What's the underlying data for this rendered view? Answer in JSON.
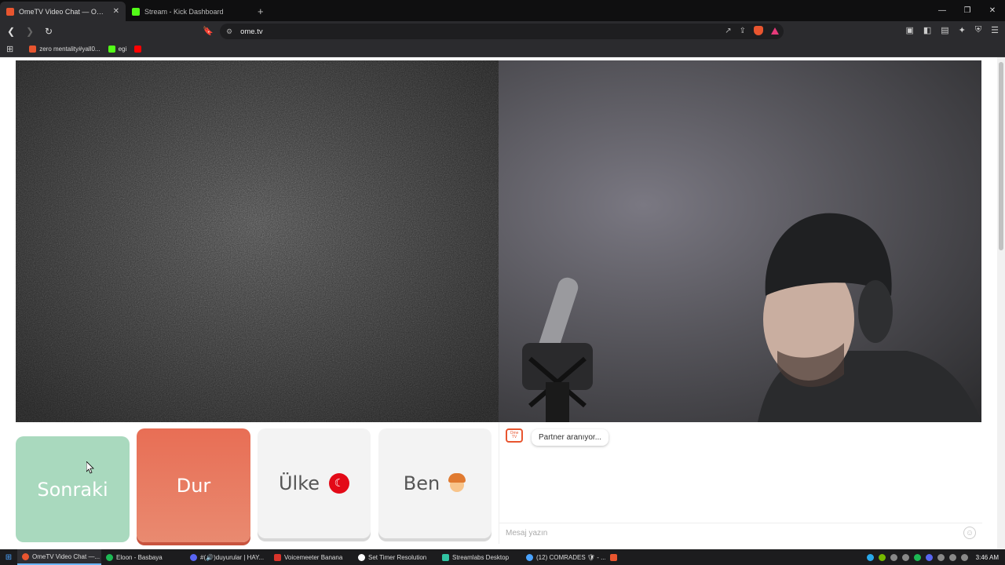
{
  "browser": {
    "tabs": [
      {
        "title": "OmeTV Video Chat — Omeg",
        "favicon_color": "#e8552f",
        "active": true
      },
      {
        "title": "Stream - Kick Dashboard",
        "favicon_color": "#53fc18",
        "active": false
      }
    ],
    "new_tab_symbol": "+",
    "window_controls": {
      "minimize": "—",
      "restore": "❐",
      "close": "✕"
    },
    "url": "ome.tv",
    "bookmarks": [
      {
        "label": "zero mentality#yall0...",
        "color": "#e8552f"
      },
      {
        "label": "egi",
        "color": "#53fc18"
      },
      {
        "label": "",
        "color": "#ff0000"
      }
    ]
  },
  "page": {
    "buttons": {
      "next": "Sonraki",
      "stop": "Dur",
      "country": "Ülke",
      "me": "Ben"
    },
    "chat": {
      "logo_text": "Ome TV",
      "status_message": "Partner aranıyor...",
      "input_placeholder": "Mesaj yazın"
    }
  },
  "taskbar": {
    "items": [
      {
        "label": "OmeTV Video Chat —...",
        "color": "#e8552f",
        "active": true
      },
      {
        "label": "Eloon - Basbaya",
        "color": "#1db954",
        "active": false
      },
      {
        "label": "#(🔊)duyurular | HAY...",
        "color": "#5865f2",
        "active": false
      },
      {
        "label": "Voicemeeter Banana",
        "color": "#d9342b",
        "active": false
      },
      {
        "label": "Set Timer Resolution",
        "color": "#ffffff",
        "active": false
      },
      {
        "label": "Streamlabs Desktop",
        "color": "#31c3a2",
        "active": false
      },
      {
        "label": "(12) COMRADES 🛡 - ...",
        "color": "#4aa3ff",
        "active": false
      },
      {
        "label": "",
        "color": "#e8552f",
        "active": false
      }
    ],
    "time": "3:46 AM"
  }
}
